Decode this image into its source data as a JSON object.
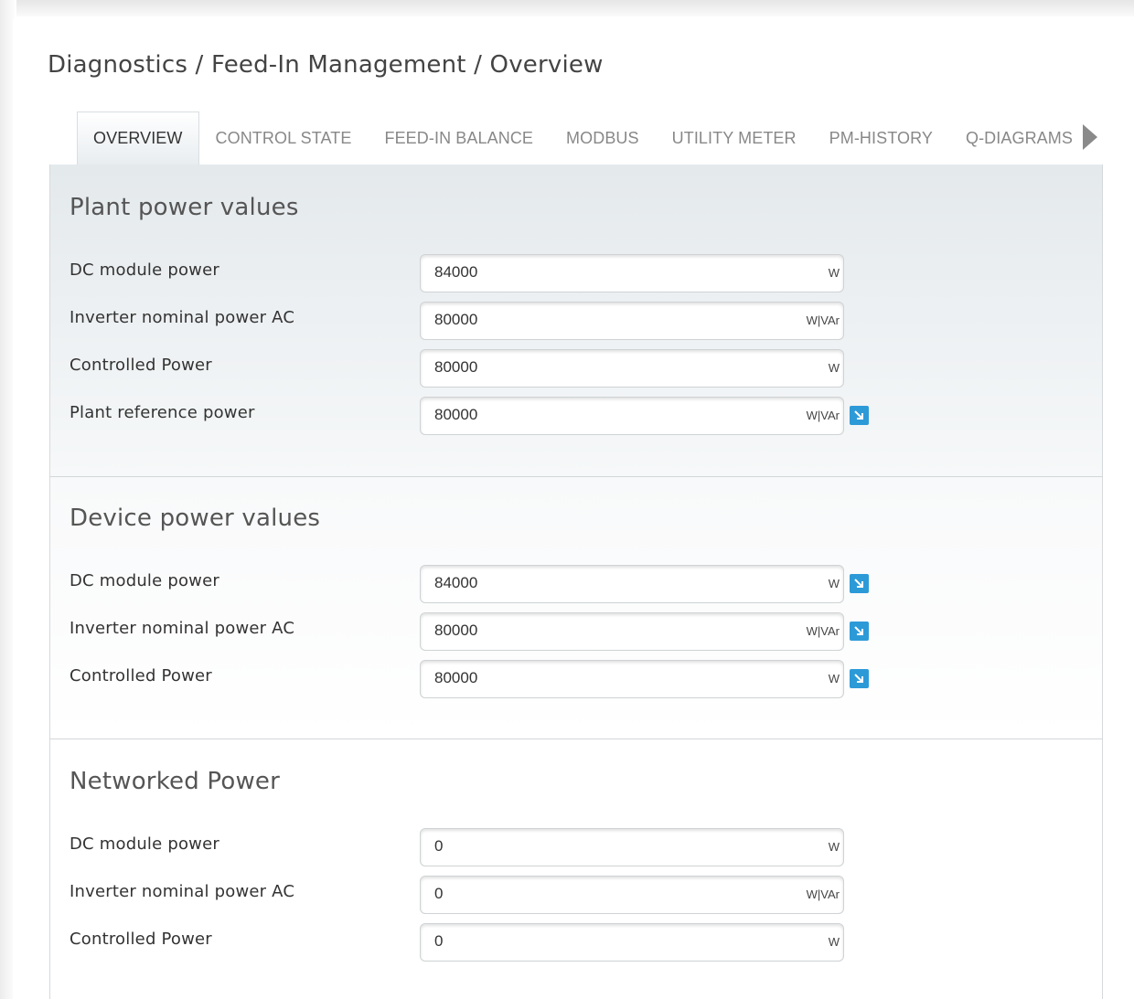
{
  "breadcrumb": "Diagnostics / Feed-In Management / Overview",
  "tabs": [
    {
      "label": "OVERVIEW",
      "active": true
    },
    {
      "label": "CONTROL STATE",
      "active": false
    },
    {
      "label": "FEED-IN BALANCE",
      "active": false
    },
    {
      "label": "MODBUS",
      "active": false
    },
    {
      "label": "UTILITY METER",
      "active": false
    },
    {
      "label": "PM-HISTORY",
      "active": false
    },
    {
      "label": "Q-DIAGRAMS",
      "active": false
    }
  ],
  "sections": [
    {
      "title": "Plant power values",
      "rows": [
        {
          "label": "DC module power",
          "value": "84000",
          "unit": "W",
          "link": false
        },
        {
          "label": "Inverter nominal power AC",
          "value": "80000",
          "unit": "W|VAr",
          "link": false
        },
        {
          "label": "Controlled Power",
          "value": "80000",
          "unit": "W",
          "link": false
        },
        {
          "label": "Plant reference power",
          "value": "80000",
          "unit": "W|VAr",
          "link": true
        }
      ]
    },
    {
      "title": "Device power values",
      "rows": [
        {
          "label": "DC module power",
          "value": "84000",
          "unit": "W",
          "link": true
        },
        {
          "label": "Inverter nominal power AC",
          "value": "80000",
          "unit": "W|VAr",
          "link": true
        },
        {
          "label": "Controlled Power",
          "value": "80000",
          "unit": "W",
          "link": true
        }
      ]
    },
    {
      "title": "Networked Power",
      "rows": [
        {
          "label": "DC module power",
          "value": "0",
          "unit": "W",
          "link": false
        },
        {
          "label": "Inverter nominal power AC",
          "value": "0",
          "unit": "W|VAr",
          "link": false
        },
        {
          "label": "Controlled Power",
          "value": "0",
          "unit": "W",
          "link": false
        }
      ]
    }
  ],
  "colors": {
    "accent": "#2d9ad8",
    "active_tab_bg": "#e8edf0"
  },
  "icons": {
    "tab_more": "triangle-right-icon",
    "row_link": "arrow-down-right-icon"
  }
}
